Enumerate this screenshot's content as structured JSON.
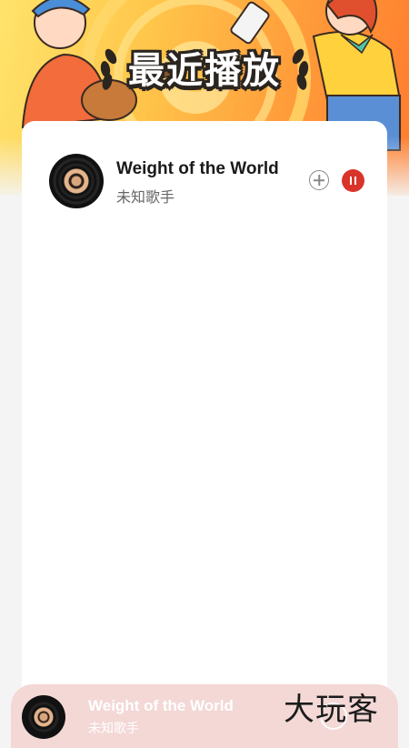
{
  "header": {
    "title": "最近播放"
  },
  "recent_list": {
    "items": [
      {
        "title": "Weight of the World",
        "artist": "未知歌手"
      }
    ]
  },
  "mini_player": {
    "title": "Weight of the World",
    "artist": "未知歌手"
  },
  "watermark": "大玩客",
  "colors": {
    "accent": "#d9342b",
    "banner_start": "#ffe36b",
    "banner_end": "#ff7c2e",
    "player_bg": "#f3d8d6"
  },
  "icons": {
    "disc": "vinyl-record-icon",
    "add": "plus-circle-icon",
    "pause": "pause-icon",
    "laurel": "laurel-icon"
  }
}
